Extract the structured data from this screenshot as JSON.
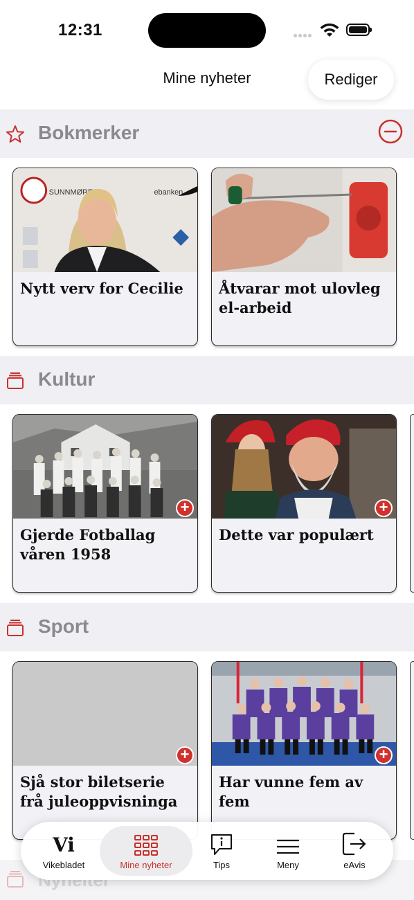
{
  "status_bar": {
    "time": "12:31"
  },
  "header": {
    "title": "Mine nyheter",
    "edit_label": "Rediger"
  },
  "sections": [
    {
      "title": "Bokmerker",
      "icon": "star-icon",
      "cards": [
        {
          "title": "Nytt verv for Cecilie"
        },
        {
          "title": "Åtvarar mot ulovleg el-arbeid"
        }
      ]
    },
    {
      "title": "Kultur",
      "icon": "stack-icon",
      "cards": [
        {
          "title": "Gjerde Fotballag våren 1958"
        },
        {
          "title": "Dette var populært"
        }
      ]
    },
    {
      "title": "Sport",
      "icon": "stack-icon",
      "cards": [
        {
          "title": "Sjå stor biletserie frå juleoppvisninga"
        },
        {
          "title": "Har vunne fem av fem"
        }
      ]
    },
    {
      "title": "Nyheiter",
      "icon": "stack-icon"
    }
  ],
  "tab_bar": {
    "items": [
      {
        "label": "Vikebladet",
        "logo": "Vi"
      },
      {
        "label": "Mine nyheter",
        "active": true
      },
      {
        "label": "Tips"
      },
      {
        "label": "Meny"
      },
      {
        "label": "eAvis"
      }
    ]
  },
  "colors": {
    "accent": "#c8312d",
    "section_bg": "#efeff4",
    "card_bg": "#f2f1f6"
  }
}
